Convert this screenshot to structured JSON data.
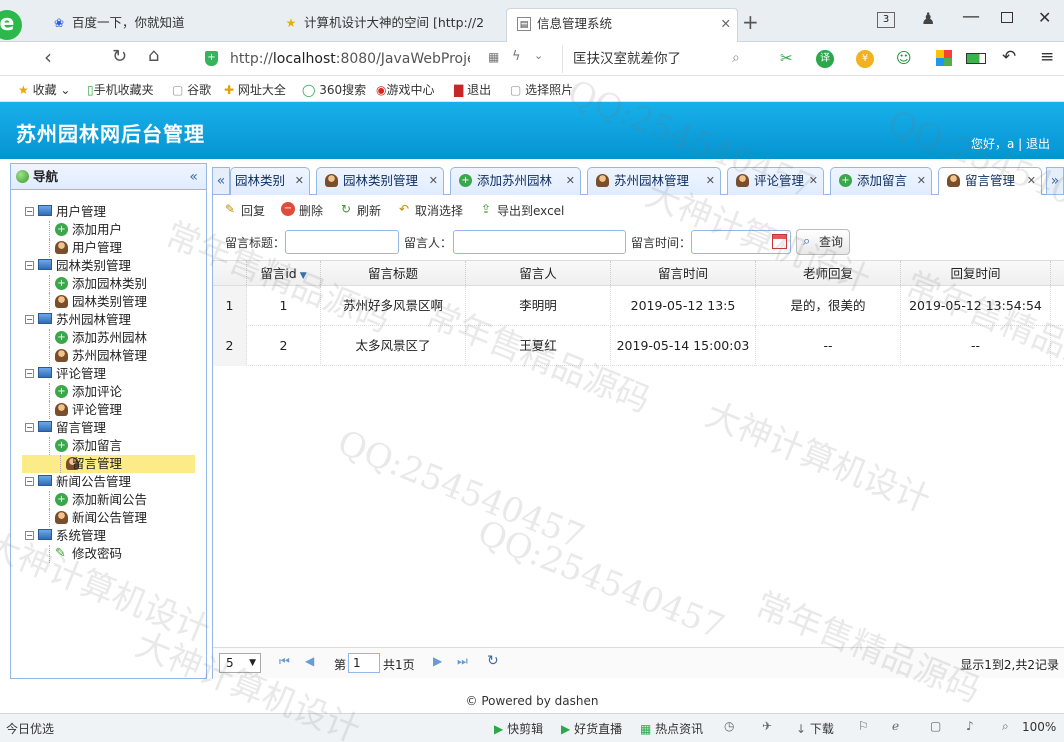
{
  "browser": {
    "tabs": [
      {
        "label": "百度一下，你就知道"
      },
      {
        "label": "计算机设计大神的空间 [http://2"
      },
      {
        "label": "信息管理系统"
      }
    ],
    "tab_count": "3",
    "url_prefix": "http://",
    "url_host": "localhost",
    "url_rest": ":8080/JavaWebProje",
    "search_text": "匡扶汉室就差你了",
    "bookmarks": [
      "收藏",
      "手机收藏夹",
      "谷歌",
      "网址大全",
      "360搜索",
      "游戏中心",
      "退出",
      "选择照片"
    ]
  },
  "app": {
    "title": "苏州园林网后台管理",
    "greeting": "您好，a | 退出"
  },
  "nav": {
    "title": "导航",
    "groups": [
      {
        "label": "用户管理",
        "items": [
          "添加用户",
          "用户管理"
        ]
      },
      {
        "label": "园林类别管理",
        "items": [
          "添加园林类别",
          "园林类别管理"
        ]
      },
      {
        "label": "苏州园林管理",
        "items": [
          "添加苏州园林",
          "苏州园林管理"
        ]
      },
      {
        "label": "评论管理",
        "items": [
          "添加评论",
          "评论管理"
        ]
      },
      {
        "label": "留言管理",
        "items": [
          "添加留言",
          "留言管理"
        ]
      },
      {
        "label": "新闻公告管理",
        "items": [
          "添加新闻公告",
          "新闻公告管理"
        ]
      },
      {
        "label": "系统管理",
        "items": [
          "修改密码"
        ]
      }
    ]
  },
  "panel_tabs": [
    "园林类别",
    "园林类别管理",
    "添加苏州园林",
    "苏州园林管理",
    "评论管理",
    "添加留言",
    "留言管理"
  ],
  "toolbar": {
    "back": "回复",
    "delete": "删除",
    "refresh": "刷新",
    "cancel_select": "取消选择",
    "export": "导出到excel"
  },
  "search": {
    "title_label": "留言标题：",
    "person_label": "留言人：",
    "time_label": "留言时间：",
    "query_button": "查询"
  },
  "grid": {
    "columns": [
      "留言id",
      "留言标题",
      "留言人",
      "留言时间",
      "老师回复",
      "回复时间"
    ],
    "rows": [
      {
        "rownum": "1",
        "id": "1",
        "title": "苏州好多风景区啊",
        "person": "李明明",
        "time": "2019-05-12 13:5",
        "reply": "是的，很美的",
        "reply_time": "2019-05-12 13:54:54"
      },
      {
        "rownum": "2",
        "id": "2",
        "title": "太多风景区了",
        "person": "王夏红",
        "time": "2019-05-14 15:00:03",
        "reply": "--",
        "reply_time": "--"
      }
    ]
  },
  "pager": {
    "page_size": "5",
    "page_prefix": "第",
    "page_value": "1",
    "page_suffix": "共1页",
    "summary": "显示1到2,共2记录"
  },
  "footer": "© Powered by dashen",
  "statusbar": {
    "left": "今日优选",
    "items": [
      "快剪辑",
      "好货直播",
      "热点资讯",
      "下载"
    ],
    "zoom": "100%"
  },
  "watermarks": [
    "QQ:254540457",
    "常年售精品源码",
    "大神计算机设计"
  ],
  "colors": {
    "header": "#0aa0dc",
    "border": "#95b8e7",
    "selected": "#fbec88"
  }
}
